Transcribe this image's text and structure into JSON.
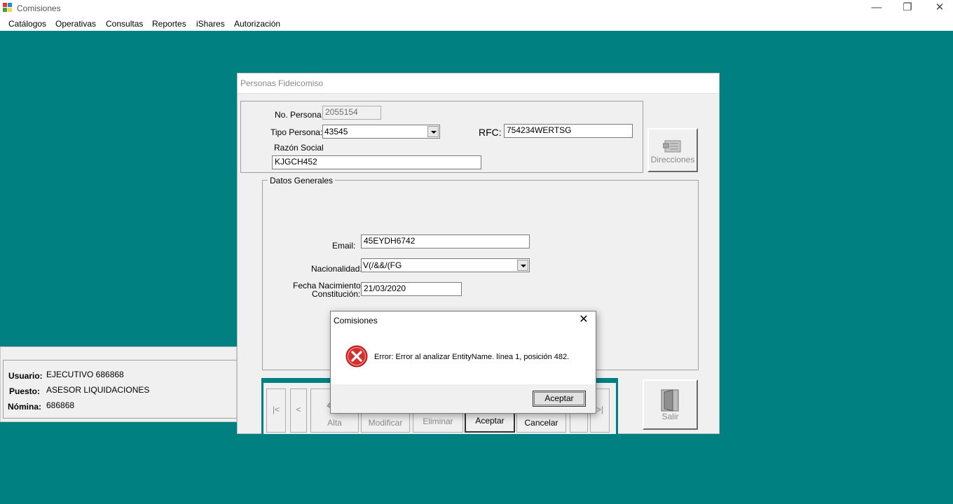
{
  "window": {
    "title": "Comisiones",
    "minimize_glyph": "—",
    "restore_glyph": "❐",
    "close_glyph": "✕"
  },
  "menu": [
    "Catálogos",
    "Operativas",
    "Consultas",
    "Reportes",
    "iShares",
    "Autorización"
  ],
  "status": {
    "usuario_label": "Usuario:",
    "usuario_value": "EJECUTIVO 686868",
    "puesto_label": "Puesto:",
    "puesto_value": "ASESOR LIQUIDACIONES",
    "nomina_label": "Nómina:",
    "nomina_value": "686868"
  },
  "form": {
    "title": "Personas Fideicomiso",
    "no_persona_label": "No. Persona:",
    "no_persona_value": "2055154",
    "tipo_persona_label": "Tipo Persona:",
    "tipo_persona_value": "43545",
    "rfc_label": "RFC:",
    "rfc_value": "754234WERTSG",
    "razon_social_label": "Razón Social",
    "razon_social_value": "KJGCH452",
    "direcciones_label": "Direcciones",
    "datos_generales_title": "Datos Generales",
    "email_label": "Email:",
    "email_value": "45EYDH6742",
    "nacionalidad_label": "Nacionalidad:",
    "nacionalidad_value": "V(/&&/(FG",
    "fecha_label_1": "Fecha Nacimiento/",
    "fecha_label_2": "Constitución:",
    "fecha_value": "21/03/2020",
    "salir_label": "Salir"
  },
  "nav": {
    "first": "|<",
    "prev": "<",
    "alta": "Alta",
    "modificar": "Modificar",
    "eliminar": "Eliminar",
    "aceptar": "Aceptar",
    "cancelar": "Cancelar",
    "next": ">",
    "last": ">|"
  },
  "dialog": {
    "title": "Comisiones",
    "close_glyph": "✕",
    "message": "Error: Error al analizar EntityName. línea 1, posición 482.",
    "ok_label": "Aceptar"
  },
  "colors": {
    "desktop": "#008080",
    "error_red": "#d32f2f"
  }
}
